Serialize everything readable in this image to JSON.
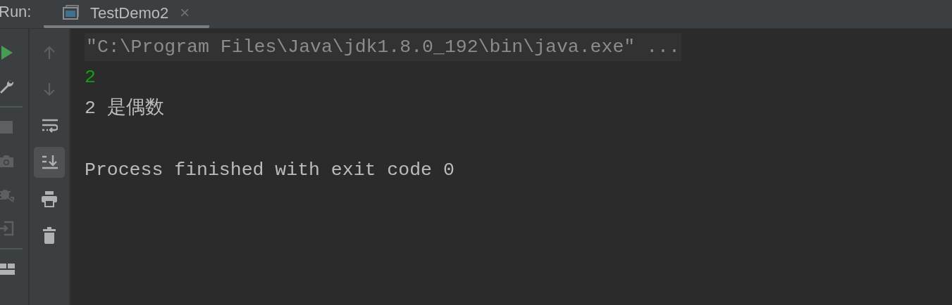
{
  "header": {
    "label": "Run:",
    "tabs": [
      {
        "title": "TestDemo2",
        "selected": true,
        "close": "×"
      }
    ]
  },
  "left_toolbar": [
    {
      "kind": "run",
      "disabled": false
    },
    {
      "kind": "wrench",
      "disabled": false
    },
    {
      "kind": "separator"
    },
    {
      "kind": "stop",
      "disabled": true
    },
    {
      "kind": "camera",
      "disabled": true
    },
    {
      "kind": "bug",
      "disabled": true
    },
    {
      "kind": "login",
      "disabled": true
    },
    {
      "kind": "separator"
    },
    {
      "kind": "layout",
      "disabled": false
    }
  ],
  "console_toolbar": [
    {
      "kind": "up",
      "disabled": true,
      "on": false
    },
    {
      "kind": "down",
      "disabled": true,
      "on": false
    },
    {
      "kind": "wrap",
      "disabled": false,
      "on": false
    },
    {
      "kind": "scroll-end",
      "disabled": false,
      "on": true
    },
    {
      "kind": "print",
      "disabled": false,
      "on": false
    },
    {
      "kind": "trash",
      "disabled": false,
      "on": false
    }
  ],
  "console": [
    {
      "kind": "command",
      "text": "\"C:\\Program Files\\Java\\jdk1.8.0_192\\bin\\java.exe\" ..."
    },
    {
      "kind": "input",
      "text": "2"
    },
    {
      "kind": "output",
      "text": "2 是偶数"
    },
    {
      "kind": "exit",
      "text": "Process finished with exit code 0"
    }
  ]
}
